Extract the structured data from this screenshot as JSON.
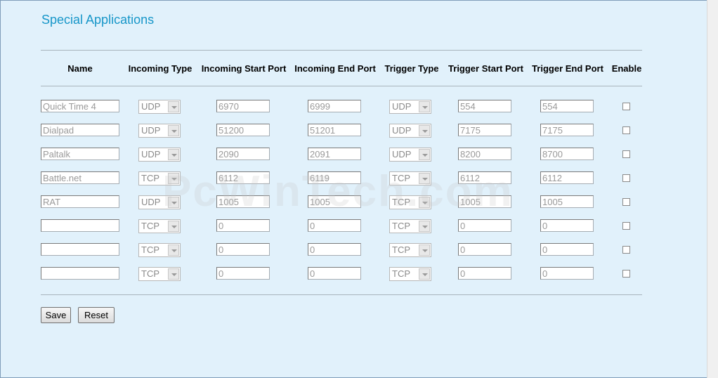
{
  "page_title": "Special Applications",
  "columns": [
    "Name",
    "Incoming Type",
    "Incoming Start Port",
    "Incoming End Port",
    "Trigger Type",
    "Trigger Start Port",
    "Trigger End Port",
    "Enable"
  ],
  "rows": [
    {
      "name": "Quick Time 4",
      "incoming_type": "UDP",
      "incoming_start": "6970",
      "incoming_end": "6999",
      "trigger_type": "UDP",
      "trigger_start": "554",
      "trigger_end": "554",
      "enabled": false
    },
    {
      "name": "Dialpad",
      "incoming_type": "UDP",
      "incoming_start": "51200",
      "incoming_end": "51201",
      "trigger_type": "UDP",
      "trigger_start": "7175",
      "trigger_end": "7175",
      "enabled": false
    },
    {
      "name": "Paltalk",
      "incoming_type": "UDP",
      "incoming_start": "2090",
      "incoming_end": "2091",
      "trigger_type": "UDP",
      "trigger_start": "8200",
      "trigger_end": "8700",
      "enabled": false
    },
    {
      "name": "Battle.net",
      "incoming_type": "TCP",
      "incoming_start": "6112",
      "incoming_end": "6119",
      "trigger_type": "TCP",
      "trigger_start": "6112",
      "trigger_end": "6112",
      "enabled": false
    },
    {
      "name": "RAT",
      "incoming_type": "UDP",
      "incoming_start": "1005",
      "incoming_end": "1005",
      "trigger_type": "TCP",
      "trigger_start": "1005",
      "trigger_end": "1005",
      "enabled": false
    },
    {
      "name": "",
      "incoming_type": "TCP",
      "incoming_start": "0",
      "incoming_end": "0",
      "trigger_type": "TCP",
      "trigger_start": "0",
      "trigger_end": "0",
      "enabled": false
    },
    {
      "name": "",
      "incoming_type": "TCP",
      "incoming_start": "0",
      "incoming_end": "0",
      "trigger_type": "TCP",
      "trigger_start": "0",
      "trigger_end": "0",
      "enabled": false
    },
    {
      "name": "",
      "incoming_type": "TCP",
      "incoming_start": "0",
      "incoming_end": "0",
      "trigger_type": "TCP",
      "trigger_start": "0",
      "trigger_end": "0",
      "enabled": false
    }
  ],
  "buttons": {
    "save": "Save",
    "reset": "Reset"
  },
  "watermark": "PcWinTech.com",
  "colors": {
    "background": "#e1f1fb",
    "title": "#1897c9",
    "disabled_text": "#9a9a9a"
  }
}
